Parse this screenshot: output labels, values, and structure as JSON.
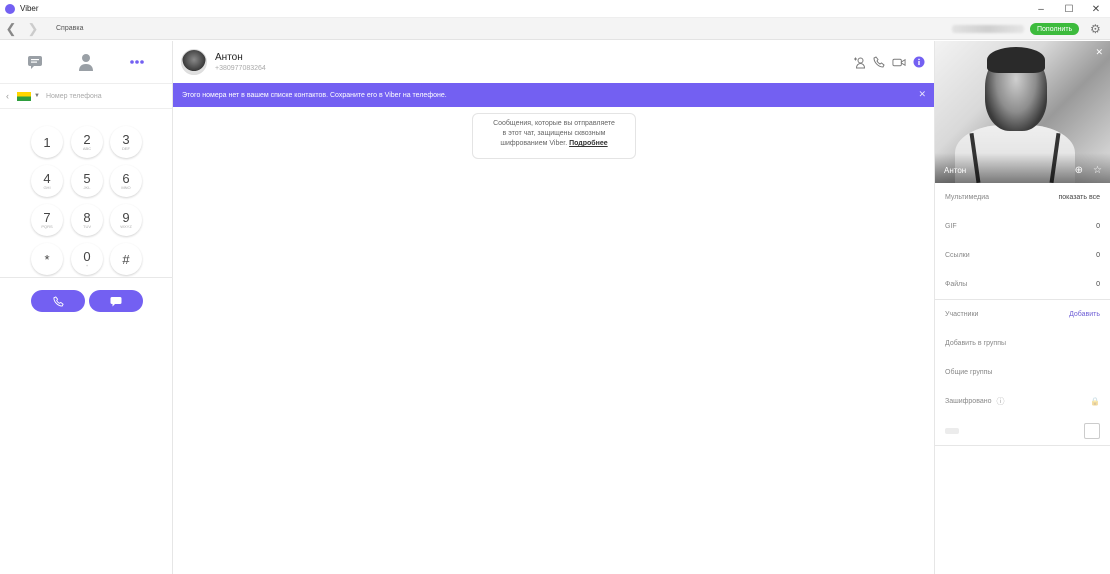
{
  "app": {
    "title": "Viber"
  },
  "window_controls": {
    "minimize": "–",
    "maximize": "☐",
    "close": "✕"
  },
  "toolbar": {
    "back": "❮",
    "forward": "❯",
    "help_menu": "Справка",
    "topup_label": "Пополнить"
  },
  "sidebar": {
    "phone_placeholder": "Номер телефона",
    "keys": [
      {
        "digit": "1",
        "letters": ""
      },
      {
        "digit": "2",
        "letters": "ABC"
      },
      {
        "digit": "3",
        "letters": "DEF"
      },
      {
        "digit": "4",
        "letters": "GHI"
      },
      {
        "digit": "5",
        "letters": "JKL"
      },
      {
        "digit": "6",
        "letters": "MNO"
      },
      {
        "digit": "7",
        "letters": "PQRS"
      },
      {
        "digit": "8",
        "letters": "TUV"
      },
      {
        "digit": "9",
        "letters": "WXYZ"
      },
      {
        "digit": "*",
        "letters": ""
      },
      {
        "digit": "0",
        "letters": "+"
      },
      {
        "digit": "#",
        "letters": ""
      }
    ]
  },
  "chat": {
    "contact_name": "Антон",
    "contact_number": "+380977083264",
    "banner_text": "Этого номера нет в вашем списке контактов. Сохраните его в Viber на телефоне.",
    "banner_close": "✕",
    "encryption_line1": "Сообщения, которые вы отправляете",
    "encryption_line2": "в этот чат, защищены сквозным",
    "encryption_line3": "шифрованием Viber.",
    "encryption_more": "Подробнее"
  },
  "info_panel": {
    "name": "Антон",
    "close": "✕",
    "media_label": "Мультимедиа",
    "media_action": "показать все",
    "gif_label": "GIF",
    "gif_count": "0",
    "links_label": "Ссылки",
    "links_count": "0",
    "files_label": "Файлы",
    "files_count": "0",
    "participants_label": "Участники",
    "participants_action": "Добавить",
    "add_to_groups": "Добавить в группы",
    "common_groups": "Общие группы",
    "encrypted_label": "Зашифровано",
    "lock_glyph": "🔒"
  },
  "colors": {
    "accent": "#7360f2",
    "topup": "#3dbb3d"
  }
}
